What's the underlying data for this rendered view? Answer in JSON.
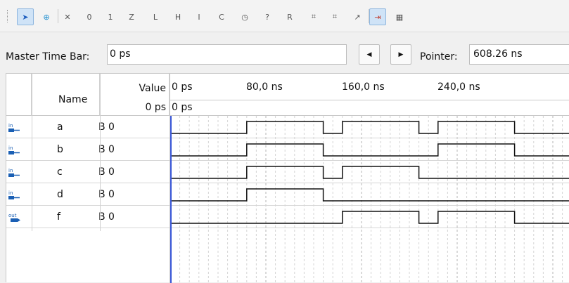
{
  "toolbar": {
    "tools": [
      {
        "icon": "selection-tool-icon",
        "active": true
      },
      {
        "icon": "zoom-tool-icon",
        "active": false
      },
      {
        "icon": "forcing-unknown-icon",
        "active": false
      },
      {
        "icon": "forcing-low-icon",
        "active": false
      },
      {
        "icon": "forcing-high-icon",
        "active": false
      },
      {
        "icon": "high-impedance-icon",
        "active": false
      },
      {
        "icon": "weak-low-icon",
        "active": false
      },
      {
        "icon": "weak-high-icon",
        "active": false
      },
      {
        "icon": "invert-icon",
        "active": false
      },
      {
        "icon": "count-value-icon",
        "active": false
      },
      {
        "icon": "clock-icon",
        "active": false
      },
      {
        "icon": "arbitrary-value-icon",
        "active": false
      },
      {
        "icon": "random-value-icon",
        "active": false
      },
      {
        "icon": "snap-to-grid-icon",
        "active": false
      },
      {
        "icon": "grid-icon",
        "active": false
      },
      {
        "icon": "overwrite-icon",
        "active": false
      },
      {
        "icon": "fit-window-icon",
        "active": true
      },
      {
        "icon": "group-bus-icon",
        "active": false
      }
    ]
  },
  "timebar": {
    "master_label": "Master Time Bar:",
    "master_value": "0 ps",
    "pointer_label": "Pointer:",
    "pointer_value": "608.26 ns"
  },
  "table": {
    "header": {
      "name": "Name",
      "value": "Value",
      "value_time": "0 ps",
      "cursor_time": "0 ps"
    },
    "ticks": [
      {
        "label": "0 ps",
        "t_ns": 0
      },
      {
        "label": "80,0 ns",
        "t_ns": 80
      },
      {
        "label": "160,0 ns",
        "t_ns": 160
      },
      {
        "label": "240,0 ns",
        "t_ns": 240
      }
    ],
    "signals": [
      {
        "dir": "in",
        "name": "a",
        "value": "B 0",
        "high": [
          [
            64,
            128
          ],
          [
            144,
            208
          ],
          [
            224,
            288
          ]
        ]
      },
      {
        "dir": "in",
        "name": "b",
        "value": "B 0",
        "high": [
          [
            64,
            128
          ],
          [
            224,
            288
          ]
        ]
      },
      {
        "dir": "in",
        "name": "c",
        "value": "B 0",
        "high": [
          [
            64,
            128
          ],
          [
            144,
            208
          ]
        ]
      },
      {
        "dir": "in",
        "name": "d",
        "value": "B 0",
        "high": [
          [
            64,
            128
          ]
        ]
      },
      {
        "dir": "out",
        "name": "f",
        "value": "B 0",
        "high": [
          [
            144,
            208
          ],
          [
            224,
            288
          ]
        ]
      }
    ]
  }
}
